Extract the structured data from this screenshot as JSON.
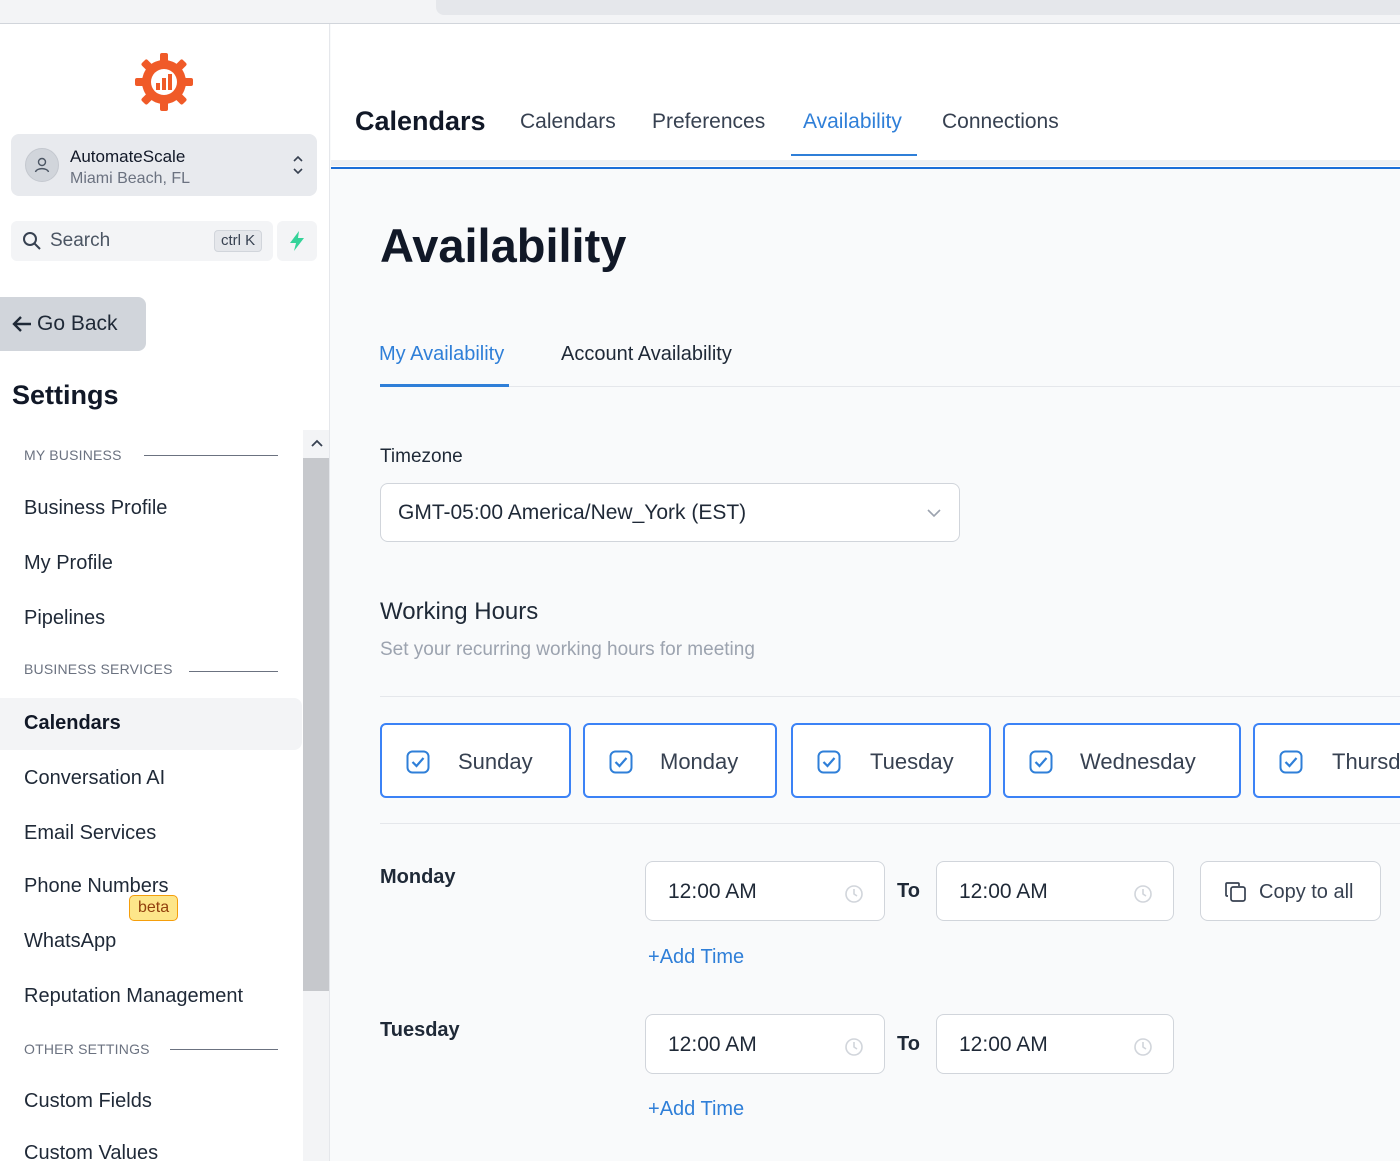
{
  "account": {
    "name": "AutomateScale",
    "location": "Miami Beach, FL"
  },
  "search": {
    "label": "Search",
    "shortcut": "ctrl K"
  },
  "sidebar": {
    "back_label": "Go Back",
    "title": "Settings",
    "sections": {
      "my_business": "MY BUSINESS",
      "business_services": "BUSINESS SERVICES",
      "other_settings": "OTHER SETTINGS"
    },
    "items": [
      {
        "label": "Business Profile"
      },
      {
        "label": "My Profile"
      },
      {
        "label": "Pipelines"
      },
      {
        "label": "Calendars",
        "active": true
      },
      {
        "label": "Conversation AI"
      },
      {
        "label": "Email Services"
      },
      {
        "label": "Phone Numbers"
      },
      {
        "label": "WhatsApp",
        "badge": "beta"
      },
      {
        "label": "Reputation Management"
      },
      {
        "label": "Custom Fields"
      },
      {
        "label": "Custom Values"
      }
    ]
  },
  "header": {
    "title": "Calendars",
    "tabs": [
      {
        "label": "Calendars"
      },
      {
        "label": "Preferences"
      },
      {
        "label": "Availability",
        "active": true
      },
      {
        "label": "Connections"
      }
    ]
  },
  "page": {
    "title": "Availability",
    "subtabs": [
      {
        "label": "My Availability",
        "active": true
      },
      {
        "label": "Account Availability"
      }
    ],
    "timezone_label": "Timezone",
    "timezone_value": "GMT-05:00 America/New_York (EST)",
    "working_hours_title": "Working Hours",
    "working_hours_subtitle": "Set your recurring working hours for meeting",
    "days": [
      {
        "label": "Sunday",
        "checked": true
      },
      {
        "label": "Monday",
        "checked": true
      },
      {
        "label": "Tuesday",
        "checked": true
      },
      {
        "label": "Wednesday",
        "checked": true
      },
      {
        "label": "Thursday",
        "checked": true
      }
    ],
    "to_label": "To",
    "add_time_label": "Add Time",
    "copy_to_all_label": "Copy to all",
    "schedule": [
      {
        "day": "Monday",
        "from": "12:00 AM",
        "to": "12:00 AM"
      },
      {
        "day": "Tuesday",
        "from": "12:00 AM",
        "to": "12:00 AM"
      }
    ]
  },
  "colors": {
    "accent": "#2f7fd8",
    "brand": "#f05a28",
    "badge": "#fde68a"
  }
}
